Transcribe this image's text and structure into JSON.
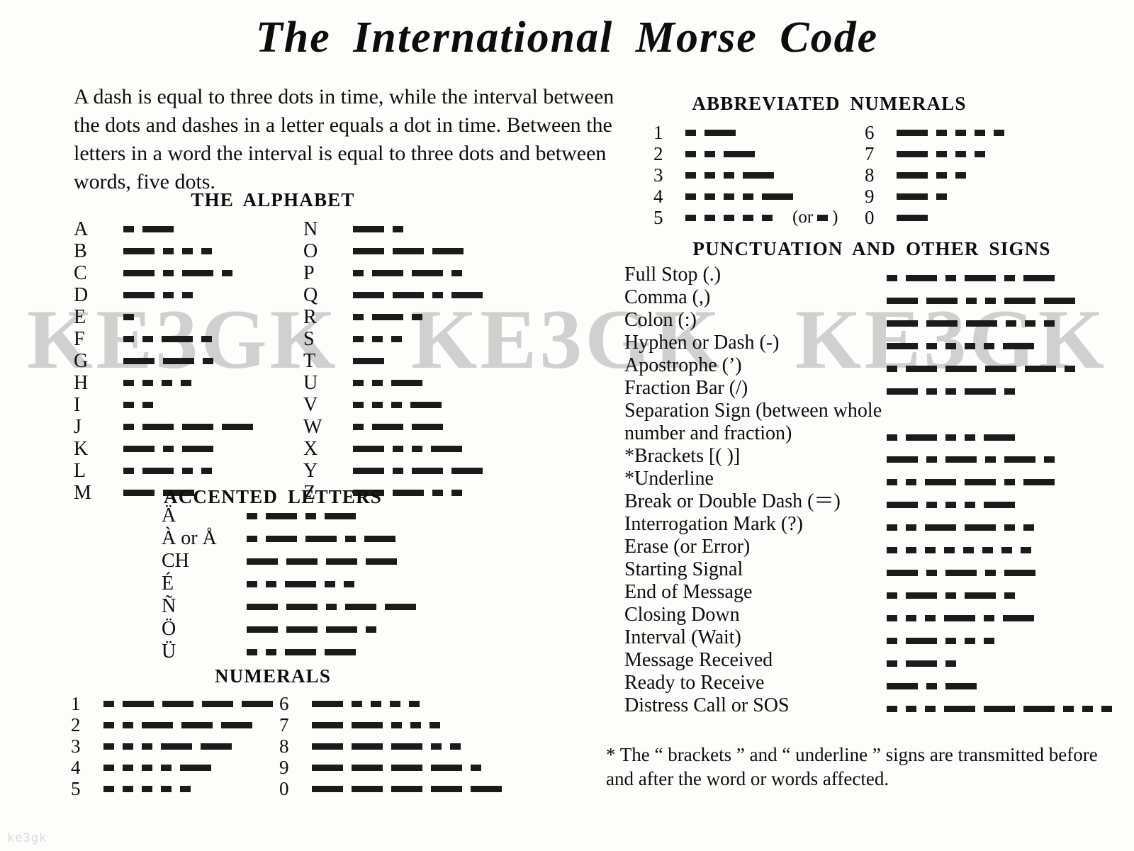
{
  "document": {
    "title": "The International Morse Code",
    "intro": "A dash is equal to three dots in time, while the interval between the dots and dashes in a letter equals a dot in time. Between the letters in a word the interval is equal to three dots and between words, five dots.",
    "footnote": "* The “ brackets ” and “ underline ” signs are transmitted before and after the word or words affected.",
    "watermark_main": "KE3GK   KE3GK   KE3GK",
    "watermark_corner": "ke3gk",
    "colors": {
      "ink": "#1b1b1b",
      "paper": "#fdfdfb",
      "watermark": "#c9c9c9"
    }
  },
  "sections": {
    "alphabet": {
      "heading": "THE ALPHABET",
      "column_left": [
        {
          "label": "A",
          "code": ".-"
        },
        {
          "label": "B",
          "code": "-..."
        },
        {
          "label": "C",
          "code": "-.-."
        },
        {
          "label": "D",
          "code": "-.."
        },
        {
          "label": "E",
          "code": "."
        },
        {
          "label": "F",
          "code": "..-."
        },
        {
          "label": "G",
          "code": "--."
        },
        {
          "label": "H",
          "code": "...."
        },
        {
          "label": "I",
          "code": ".."
        },
        {
          "label": "J",
          "code": ".---"
        },
        {
          "label": "K",
          "code": "-.-"
        },
        {
          "label": "L",
          "code": ".-.."
        },
        {
          "label": "M",
          "code": "--"
        }
      ],
      "column_right": [
        {
          "label": "N",
          "code": "-."
        },
        {
          "label": "O",
          "code": "---"
        },
        {
          "label": "P",
          "code": ".--."
        },
        {
          "label": "Q",
          "code": "--.-"
        },
        {
          "label": "R",
          "code": ".-."
        },
        {
          "label": "S",
          "code": "..."
        },
        {
          "label": "T",
          "code": "-"
        },
        {
          "label": "U",
          "code": "..-"
        },
        {
          "label": "V",
          "code": "...-"
        },
        {
          "label": "W",
          "code": ".--"
        },
        {
          "label": "X",
          "code": "-..-"
        },
        {
          "label": "Y",
          "code": "-.--"
        },
        {
          "label": "Z",
          "code": "--.."
        }
      ]
    },
    "accented": {
      "heading": "ACCENTED LETTERS",
      "rows": [
        {
          "label": "Ä",
          "code": ".-.-"
        },
        {
          "label": "À or Å",
          "code": ".--.-"
        },
        {
          "label": "CH",
          "code": "----"
        },
        {
          "label": "É",
          "code": "..-.."
        },
        {
          "label": "Ñ",
          "code": "--.--"
        },
        {
          "label": "Ö",
          "code": "---."
        },
        {
          "label": "Ü",
          "code": "..--"
        }
      ]
    },
    "numerals": {
      "heading": "NUMERALS",
      "column_left": [
        {
          "label": "1",
          "code": ".----"
        },
        {
          "label": "2",
          "code": "..---"
        },
        {
          "label": "3",
          "code": "...--"
        },
        {
          "label": "4",
          "code": "....-"
        },
        {
          "label": "5",
          "code": "....."
        }
      ],
      "column_right": [
        {
          "label": "6",
          "code": "-...."
        },
        {
          "label": "7",
          "code": "--..."
        },
        {
          "label": "8",
          "code": "---.."
        },
        {
          "label": "9",
          "code": "----."
        },
        {
          "label": "0",
          "code": "-----"
        }
      ]
    },
    "abbreviated_numerals": {
      "heading": "ABBREVIATED NUMERALS",
      "column_left": [
        {
          "label": "1",
          "code": ".-",
          "alt_prefix": "",
          "alt_code": "",
          "alt_suffix": ""
        },
        {
          "label": "2",
          "code": "..-",
          "alt_prefix": "",
          "alt_code": "",
          "alt_suffix": ""
        },
        {
          "label": "3",
          "code": "...-",
          "alt_prefix": "",
          "alt_code": "",
          "alt_suffix": ""
        },
        {
          "label": "4",
          "code": "....-",
          "alt_prefix": "",
          "alt_code": "",
          "alt_suffix": ""
        },
        {
          "label": "5",
          "code": ".....",
          "alt_prefix": "(or",
          "alt_code": ".",
          "alt_suffix": ")"
        }
      ],
      "column_right": [
        {
          "label": "6",
          "code": "-...."
        },
        {
          "label": "7",
          "code": "-..."
        },
        {
          "label": "8",
          "code": "-.."
        },
        {
          "label": "9",
          "code": "-."
        },
        {
          "label": "0",
          "code": "-"
        }
      ]
    },
    "punctuation": {
      "heading": "PUNCTUATION AND OTHER SIGNS",
      "rows": [
        {
          "name": "Full Stop (.)",
          "code": ".-.-.-"
        },
        {
          "name": "Comma (,)",
          "code": "--..--"
        },
        {
          "name": "Colon (:)",
          "code": "---..."
        },
        {
          "name": "Hyphen or Dash (-)",
          "code": "-....-"
        },
        {
          "name": "Apostrophe (’)",
          "code": ".----."
        },
        {
          "name": "Fraction Bar (/)",
          "code": "-..-."
        },
        {
          "name": "Separation Sign (between whole number and fraction)",
          "code": ".-..-"
        },
        {
          "name": "*Brackets [( )]",
          "code": "-.-.-."
        },
        {
          "name": "*Underline",
          "code": "..--.-"
        },
        {
          "name": "Break or Double Dash (＝)",
          "code": "-...-"
        },
        {
          "name": "Interrogation Mark (?)",
          "code": "..--.."
        },
        {
          "name": "Erase (or Error)",
          "code": "........"
        },
        {
          "name": "Starting Signal",
          "code": "-.-.-"
        },
        {
          "name": "End of Message",
          "code": ".-.-."
        },
        {
          "name": "Closing Down",
          "code": "...-.-"
        },
        {
          "name": "Interval (Wait)",
          "code": ".-..."
        },
        {
          "name": "Message Received",
          "code": ".-."
        },
        {
          "name": "Ready to Receive",
          "code": "-.-"
        },
        {
          "name": "Distress Call or SOS",
          "code": "...---..."
        }
      ]
    }
  }
}
